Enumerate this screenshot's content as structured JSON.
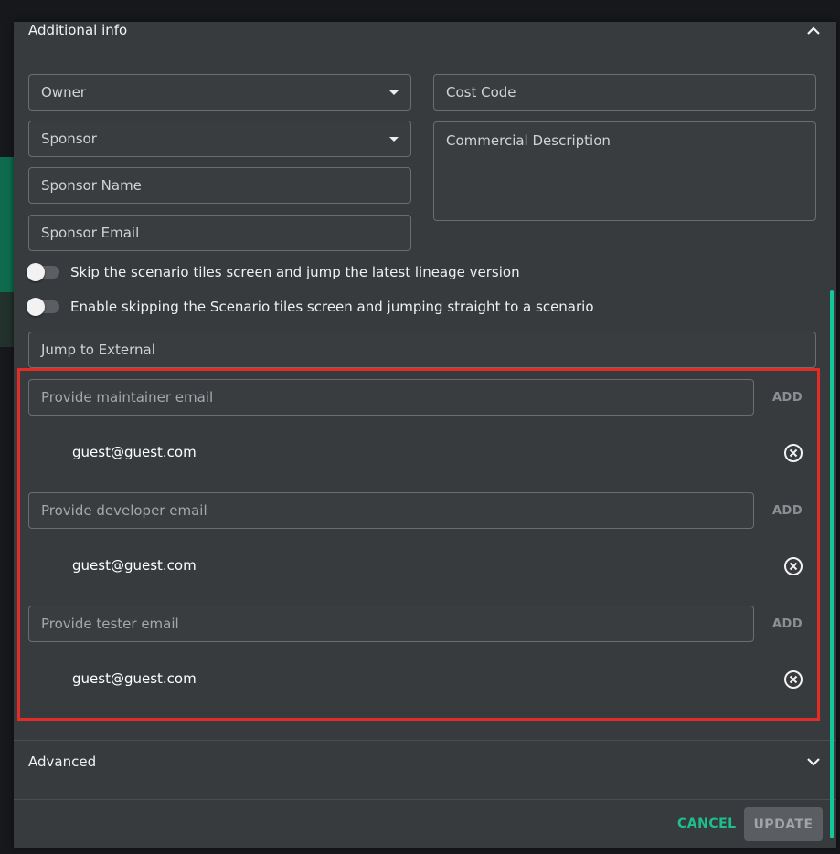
{
  "sections": {
    "additional_info": "Additional info",
    "advanced": "Advanced"
  },
  "fields": {
    "owner": "Owner",
    "sponsor": "Sponsor",
    "sponsor_name": "Sponsor Name",
    "sponsor_email": "Sponsor Email",
    "cost_code": "Cost Code",
    "commercial_description": "Commercial Description",
    "jump_to_external": "Jump to External"
  },
  "toggles": [
    {
      "label": "Skip the scenario tiles screen and jump the latest lineage version",
      "on": false
    },
    {
      "label": "Enable skipping the Scenario tiles screen and jumping straight to a scenario",
      "on": false
    }
  ],
  "email_groups": [
    {
      "placeholder": "Provide maintainer email",
      "add_label": "ADD",
      "emails": [
        "guest@guest.com"
      ]
    },
    {
      "placeholder": "Provide developer email",
      "add_label": "ADD",
      "emails": [
        "guest@guest.com"
      ]
    },
    {
      "placeholder": "Provide tester email",
      "add_label": "ADD",
      "emails": [
        "guest@guest.com"
      ]
    }
  ],
  "footer": {
    "cancel": "CANCEL",
    "update": "UPDATE"
  },
  "colors": {
    "accent": "#1dc08d",
    "highlight": "#e52b26",
    "dialog_bg": "#383b3e"
  }
}
